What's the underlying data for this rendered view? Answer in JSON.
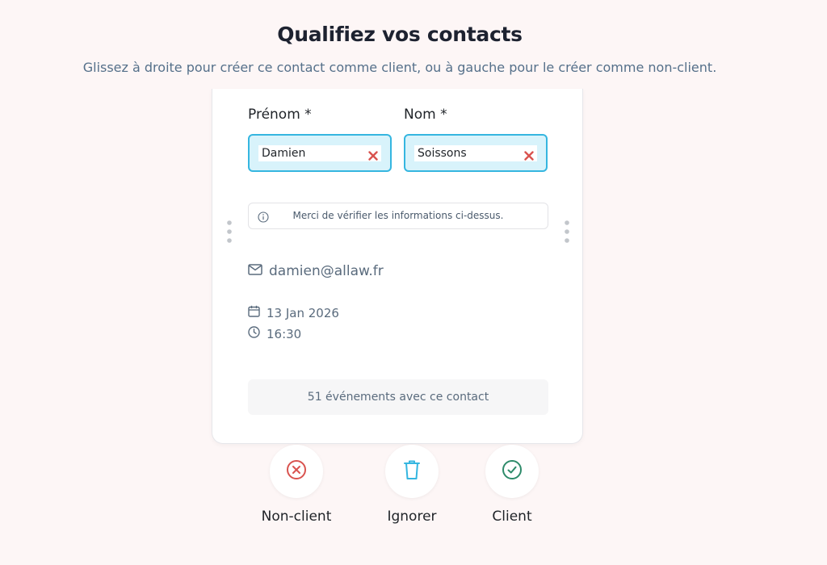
{
  "header": {
    "title": "Qualifiez vos contacts",
    "subtitle": "Glissez à droite pour créer ce contact comme client, ou à gauche pour le créer comme non-client."
  },
  "card": {
    "first_name": {
      "label": "Prénom *",
      "value": "Damien",
      "clear_icon": "close-x-icon"
    },
    "last_name": {
      "label": "Nom *",
      "value": "Soissons",
      "clear_icon": "close-x-icon"
    },
    "notice": {
      "icon": "info-icon",
      "text": "Merci de vérifier les informations ci-dessus."
    },
    "email": {
      "icon": "mail-icon",
      "value": "damien@allaw.fr"
    },
    "date": {
      "icon": "calendar-icon",
      "value": "13 Jan 2026"
    },
    "time": {
      "icon": "clock-icon",
      "value": "16:30"
    },
    "events": "51 événements avec ce contact"
  },
  "actions": [
    {
      "label": "Non-client",
      "icon": "circle-x-icon",
      "color": "#d9534f"
    },
    {
      "label": "Ignorer",
      "icon": "trash-icon",
      "color": "#35b6e0"
    },
    {
      "label": "Client",
      "icon": "circle-check-icon",
      "color": "#2e8b6a"
    }
  ],
  "colors": {
    "background": "#fdf6f6",
    "accent": "#35b6e0",
    "field_bg": "#d8f3fb",
    "clear": "#d9534f"
  }
}
